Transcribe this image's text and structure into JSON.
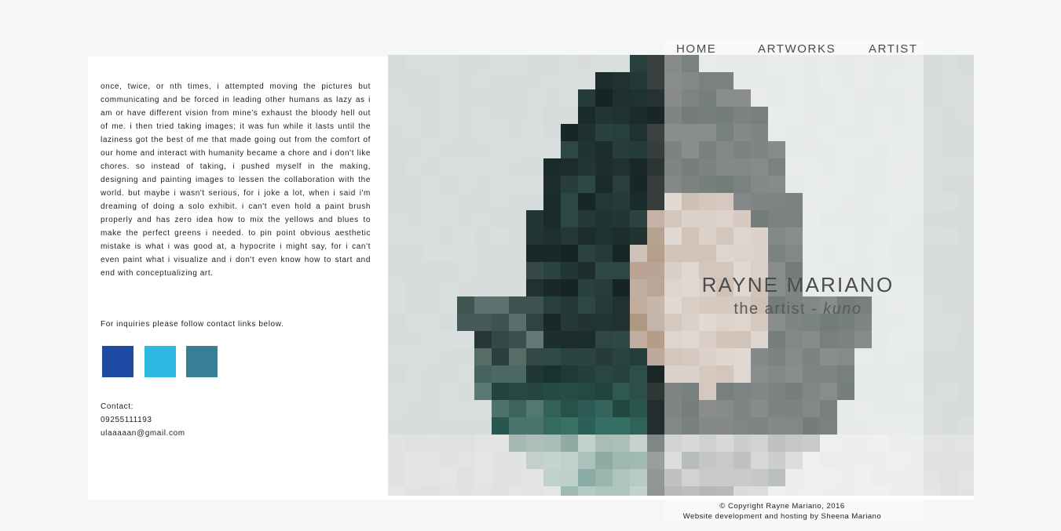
{
  "nav": {
    "home": "HOME",
    "artworks": "ARTWORKS",
    "artist": "ARTIST"
  },
  "bio": {
    "text": "once, twice, or nth times, i attempted moving the pictures but communicating and be forced in leading other humans as lazy as i am or have different vision from mine's exhaust the bloody hell out of me. i then tried taking images; it was fun while it lasts until the laziness got the best of me that made going out from the comfort of our home and interact with humanity became a chore and i don't like chores. so instead of taking, i pushed myself in the making, designing and painting images to lessen the collaboration with the world. but maybe i wasn't serious, for i joke a lot, when i said i'm dreaming of doing a solo exhibit. i can't even hold a paint brush properly and has zero idea how to mix the yellows and blues to make the perfect greens i needed. to pin point obvious aesthetic mistake is what i was good at, a hypocrite i might say, for i can't even paint what i visualize and i don't even know how to start and end with conceptualizing art."
  },
  "inquiry": "For inquiries please follow contact links below.",
  "social": [
    {
      "icon": "facebook-icon",
      "color": "#1f4aa3"
    },
    {
      "icon": "twitter-icon",
      "color": "#2db8e1"
    },
    {
      "icon": "tumblr-icon",
      "color": "#367f94"
    }
  ],
  "contact": {
    "label": "Contact:",
    "phone": "09255111193",
    "email": "ulaaaaan@gmail.com"
  },
  "hero": {
    "name": "RAYNE MARIANO",
    "subtitle_prefix": "the artist - ",
    "subtitle_emphasis": "kuno"
  },
  "footer": {
    "copyright": "© Copyright Rayne Mariano, 2016",
    "credit": "Website development and hosting by Sheena Mariano"
  },
  "colors": {
    "background": "#f6f6f6",
    "card": "#ffffff",
    "text": "#1e1e1e"
  }
}
